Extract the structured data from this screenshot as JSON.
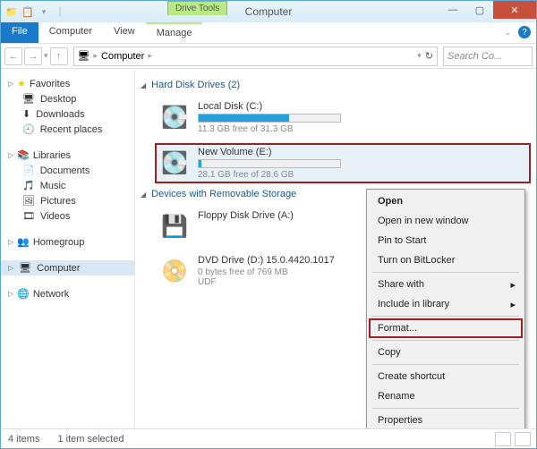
{
  "titlebar": {
    "tools_label": "Drive Tools",
    "title": "Computer"
  },
  "ribbon": {
    "file": "File",
    "computer": "Computer",
    "view": "View",
    "manage": "Manage"
  },
  "nav": {
    "breadcrumb": "Computer",
    "search_placeholder": "Search Co..."
  },
  "sidebar": {
    "favorites": {
      "label": "Favorites",
      "items": [
        "Desktop",
        "Downloads",
        "Recent places"
      ]
    },
    "libraries": {
      "label": "Libraries",
      "items": [
        "Documents",
        "Music",
        "Pictures",
        "Videos"
      ]
    },
    "homegroup": "Homegroup",
    "computer": "Computer",
    "network": "Network"
  },
  "main": {
    "hdd_header": "Hard Disk Drives (2)",
    "drives": [
      {
        "name": "Local Disk (C:)",
        "free": "11.3 GB free of 31.3 GB",
        "fill_pct": 64
      },
      {
        "name": "New Volume (E:)",
        "free": "28.1 GB free of 28.6 GB",
        "fill_pct": 2
      }
    ],
    "removable_header": "Devices with Removable Storage",
    "removable": [
      {
        "name": "Floppy Disk Drive (A:)",
        "sub": ""
      },
      {
        "name": "DVD Drive (D:) 15.0.4420.1017",
        "sub": "0 bytes free of 769 MB",
        "sub2": "UDF"
      }
    ]
  },
  "context": {
    "open": "Open",
    "open_new": "Open in new window",
    "pin": "Pin to Start",
    "bitlocker": "Turn on BitLocker",
    "share": "Share with",
    "include": "Include in library",
    "format": "Format...",
    "copy": "Copy",
    "shortcut": "Create shortcut",
    "rename": "Rename",
    "properties": "Properties"
  },
  "status": {
    "items": "4 items",
    "selected": "1 item selected"
  }
}
